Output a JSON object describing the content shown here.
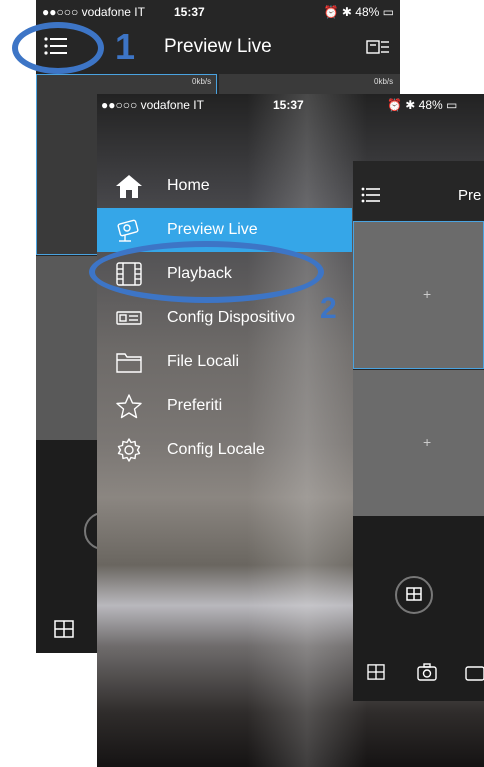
{
  "back_screen": {
    "status": {
      "carrier": "●●○○○ vodafone IT",
      "time": "15:37",
      "battery": "48%"
    },
    "header": {
      "title": "Preview Live"
    },
    "tiles": {
      "left_rate": "0kb/s",
      "right_rate": "0kb/s"
    }
  },
  "front_screen": {
    "status": {
      "carrier": "●●○○○ vodafone IT",
      "time": "15:37",
      "battery": "48%"
    },
    "menu": [
      {
        "label": "Home",
        "icon": "home-icon"
      },
      {
        "label": "Preview Live",
        "icon": "camera-icon",
        "active": true
      },
      {
        "label": "Playback",
        "icon": "film-icon"
      },
      {
        "label": "Config Dispositivo",
        "icon": "device-icon"
      },
      {
        "label": "File Locali",
        "icon": "folder-icon"
      },
      {
        "label": "Preferiti",
        "icon": "star-icon"
      },
      {
        "label": "Config Locale",
        "icon": "gear-icon"
      }
    ],
    "inner_preview": {
      "title": "Pre"
    }
  },
  "annotations": {
    "step1": "1",
    "step2": "2"
  },
  "colors": {
    "accent": "#35a6e8",
    "annotation": "#3d75c6"
  }
}
